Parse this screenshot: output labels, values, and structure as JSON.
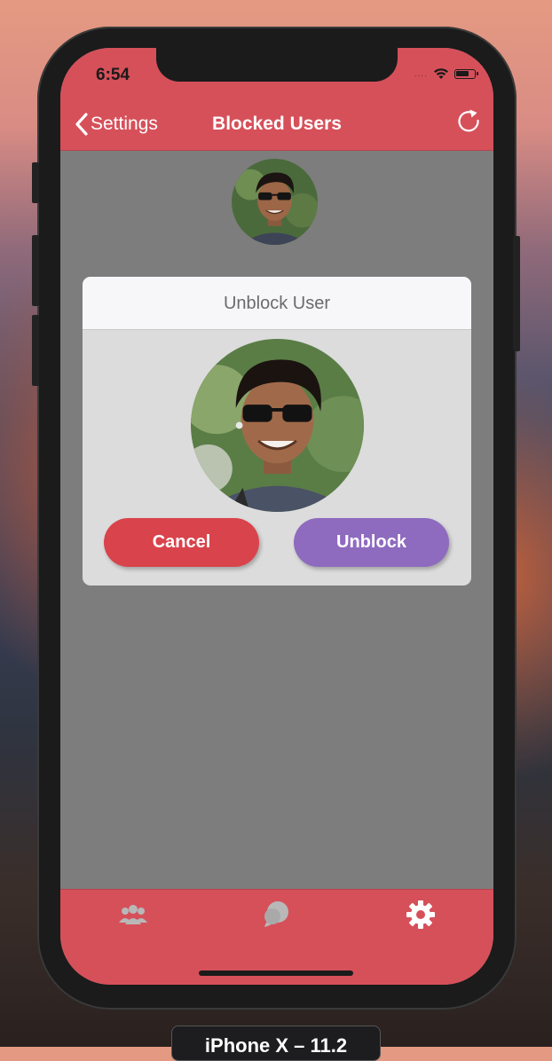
{
  "status": {
    "time": "6:54",
    "signal": "....",
    "wifi_icon": "wifi-icon",
    "battery_icon": "battery-icon"
  },
  "nav": {
    "back_label": "Settings",
    "title": "Blocked Users",
    "refresh_icon": "refresh-icon"
  },
  "dialog": {
    "title": "Unblock User",
    "cancel_label": "Cancel",
    "unblock_label": "Unblock"
  },
  "tabbar": {
    "items": [
      {
        "icon": "contacts-icon",
        "active": false
      },
      {
        "icon": "chat-bubble-icon",
        "active": false
      },
      {
        "icon": "gear-icon",
        "active": true
      }
    ]
  },
  "device_label": "iPhone X – 11.2",
  "colors": {
    "accent": "#d6505a",
    "cancel": "#d9434b",
    "unblock": "#8e6bbf",
    "backdrop": "#7d7d7d"
  }
}
